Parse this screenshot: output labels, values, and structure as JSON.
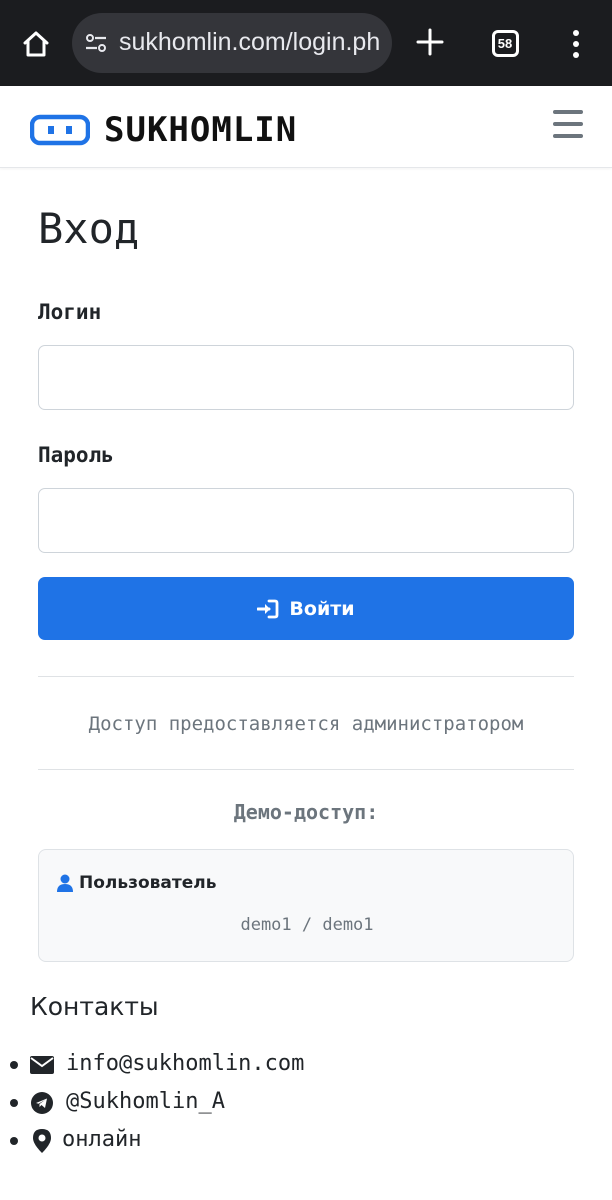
{
  "browser": {
    "url": "sukhomlin.com/login.ph",
    "tab_count": "58",
    "icons": [
      "home-icon",
      "site-settings-icon",
      "new-tab-icon",
      "tabs-icon",
      "more-vert-icon"
    ]
  },
  "header": {
    "brand_name": "SUKHOMLIN",
    "logo_color": "#1f73e6"
  },
  "login": {
    "title": "Вход",
    "login_label": "Логин",
    "login_value": "",
    "password_label": "Пароль",
    "password_value": "",
    "submit_label": "Войти",
    "access_note": "Доступ предоставляется администратором",
    "demo_title": "Демо-доступ:",
    "demo_user_label": "Пользователь",
    "demo_credentials": "demo1 / demo1"
  },
  "contacts": {
    "title": "Контакты",
    "items": [
      {
        "icon": "envelope-icon",
        "text": "info@sukhomlin.com"
      },
      {
        "icon": "telegram-icon",
        "text": "@Sukhomlin_A"
      },
      {
        "icon": "map-pin-icon",
        "text": "онлайн"
      }
    ]
  },
  "colors": {
    "accent": "#1f73e6",
    "chrome_bg": "#1b1c1f",
    "muted_text": "#6c757d"
  }
}
